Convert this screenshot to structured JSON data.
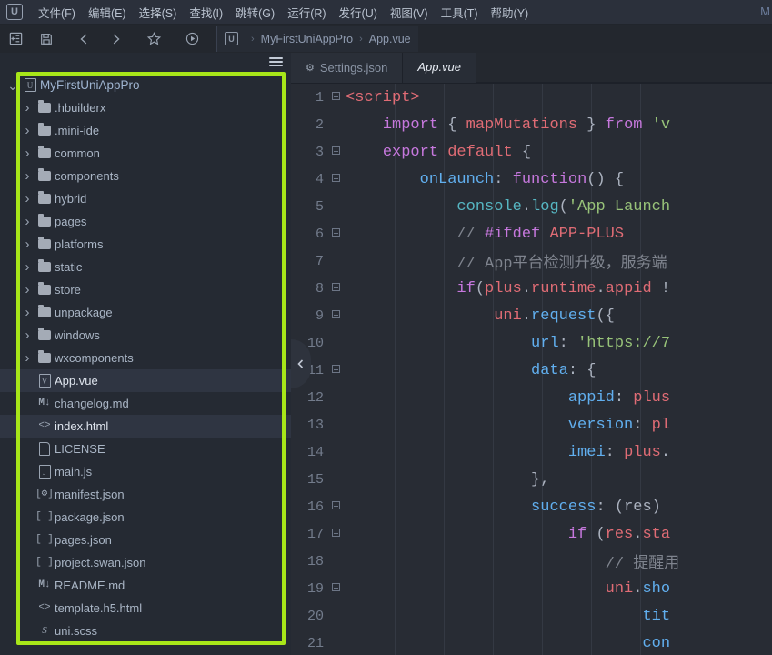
{
  "app": {
    "logo_letter": "U",
    "right_label": "M"
  },
  "menubar": {
    "items": [
      {
        "name": "file",
        "label": "文件(F)"
      },
      {
        "name": "edit",
        "label": "编辑(E)"
      },
      {
        "name": "select",
        "label": "选择(S)"
      },
      {
        "name": "find",
        "label": "查找(I)"
      },
      {
        "name": "goto",
        "label": "跳转(G)"
      },
      {
        "name": "run",
        "label": "运行(R)"
      },
      {
        "name": "publish",
        "label": "发行(U)"
      },
      {
        "name": "view",
        "label": "视图(V)"
      },
      {
        "name": "tools",
        "label": "工具(T)"
      },
      {
        "name": "help",
        "label": "帮助(Y)"
      }
    ]
  },
  "toolbar": {
    "buttons": [
      {
        "name": "new-file-button",
        "icon": "new-file-icon"
      },
      {
        "name": "save-button",
        "icon": "save-icon"
      },
      {
        "name": "back-button",
        "icon": "chevron-left-icon"
      },
      {
        "name": "forward-button",
        "icon": "chevron-right-icon"
      },
      {
        "name": "favorite-button",
        "icon": "star-icon"
      },
      {
        "name": "run-button",
        "icon": "play-circle-icon"
      }
    ],
    "breadcrumb": {
      "logo_letter": "U",
      "separator": "›",
      "items": [
        "MyFirstUniAppPro",
        "App.vue"
      ]
    }
  },
  "sidebar": {
    "menu_icon": "hamburger-icon",
    "tree": [
      {
        "label": "MyFirstUniAppPro",
        "type": "root",
        "icon": "project-icon",
        "expanded": true,
        "indent": 0,
        "selected": false
      },
      {
        "label": ".hbuilderx",
        "type": "folder",
        "icon": "folder-icon",
        "expanded": false,
        "indent": 1,
        "selected": false
      },
      {
        "label": ".mini-ide",
        "type": "folder",
        "icon": "folder-icon",
        "expanded": false,
        "indent": 1,
        "selected": false
      },
      {
        "label": "common",
        "type": "folder",
        "icon": "folder-icon",
        "expanded": false,
        "indent": 1,
        "selected": false
      },
      {
        "label": "components",
        "type": "folder",
        "icon": "folder-icon",
        "expanded": false,
        "indent": 1,
        "selected": false
      },
      {
        "label": "hybrid",
        "type": "folder",
        "icon": "folder-icon",
        "expanded": false,
        "indent": 1,
        "selected": false
      },
      {
        "label": "pages",
        "type": "folder",
        "icon": "folder-icon",
        "expanded": false,
        "indent": 1,
        "selected": false
      },
      {
        "label": "platforms",
        "type": "folder",
        "icon": "folder-icon",
        "expanded": false,
        "indent": 1,
        "selected": false
      },
      {
        "label": "static",
        "type": "folder",
        "icon": "folder-icon",
        "expanded": false,
        "indent": 1,
        "selected": false
      },
      {
        "label": "store",
        "type": "folder",
        "icon": "folder-icon",
        "expanded": false,
        "indent": 1,
        "selected": false
      },
      {
        "label": "unpackage",
        "type": "folder",
        "icon": "folder-icon",
        "expanded": false,
        "indent": 1,
        "selected": false
      },
      {
        "label": "windows",
        "type": "folder",
        "icon": "folder-icon",
        "expanded": false,
        "indent": 1,
        "selected": false
      },
      {
        "label": "wxcomponents",
        "type": "folder",
        "icon": "folder-icon",
        "expanded": false,
        "indent": 1,
        "selected": false
      },
      {
        "label": "App.vue",
        "type": "file",
        "icon": "vue-file-icon",
        "indent": 1,
        "selected": true
      },
      {
        "label": "changelog.md",
        "type": "file",
        "icon": "markdown-file-icon",
        "indent": 1,
        "selected": false
      },
      {
        "label": "index.html",
        "type": "file",
        "icon": "html-file-icon",
        "indent": 1,
        "selected": true
      },
      {
        "label": "LICENSE",
        "type": "file",
        "icon": "plain-file-icon",
        "indent": 1,
        "selected": false
      },
      {
        "label": "main.js",
        "type": "file",
        "icon": "js-file-icon",
        "indent": 1,
        "selected": false
      },
      {
        "label": "manifest.json",
        "type": "file",
        "icon": "manifest-file-icon",
        "indent": 1,
        "selected": false
      },
      {
        "label": "package.json",
        "type": "file",
        "icon": "json-file-icon",
        "indent": 1,
        "selected": false
      },
      {
        "label": "pages.json",
        "type": "file",
        "icon": "json-file-icon",
        "indent": 1,
        "selected": false
      },
      {
        "label": "project.swan.json",
        "type": "file",
        "icon": "json-file-icon",
        "indent": 1,
        "selected": false
      },
      {
        "label": "README.md",
        "type": "file",
        "icon": "markdown-file-icon",
        "indent": 1,
        "selected": false
      },
      {
        "label": "template.h5.html",
        "type": "file",
        "icon": "html-file-icon",
        "indent": 1,
        "selected": false
      },
      {
        "label": "uni.scss",
        "type": "file",
        "icon": "scss-file-icon",
        "indent": 1,
        "selected": false
      }
    ],
    "highlight_color": "#a8e619"
  },
  "editor": {
    "tabs": [
      {
        "label": "Settings.json",
        "icon": "gear-icon",
        "active": false
      },
      {
        "label": "App.vue",
        "icon": "",
        "active": true
      }
    ],
    "collapse_handle_icon": "chevron-left-icon",
    "code": {
      "language": "vue",
      "lines": [
        {
          "no": "1",
          "fold": "box",
          "indent": 0,
          "tokens": [
            {
              "t": "tag",
              "v": "<script>"
            }
          ]
        },
        {
          "no": "2",
          "fold": "bar",
          "indent": 1,
          "tokens": [
            {
              "t": "plain",
              "v": "    "
            },
            {
              "t": "kw",
              "v": "import"
            },
            {
              "t": "plain",
              "v": " "
            },
            {
              "t": "punc",
              "v": "{"
            },
            {
              "t": "plain",
              "v": " "
            },
            {
              "t": "var",
              "v": "mapMutations"
            },
            {
              "t": "plain",
              "v": " "
            },
            {
              "t": "punc",
              "v": "}"
            },
            {
              "t": "plain",
              "v": " "
            },
            {
              "t": "kw",
              "v": "from"
            },
            {
              "t": "plain",
              "v": " "
            },
            {
              "t": "str",
              "v": "'v"
            }
          ]
        },
        {
          "no": "3",
          "fold": "box",
          "indent": 1,
          "tokens": [
            {
              "t": "plain",
              "v": "    "
            },
            {
              "t": "kw",
              "v": "export"
            },
            {
              "t": "plain",
              "v": " "
            },
            {
              "t": "var",
              "v": "default"
            },
            {
              "t": "plain",
              "v": " "
            },
            {
              "t": "punc",
              "v": "{"
            }
          ]
        },
        {
          "no": "4",
          "fold": "box",
          "indent": 2,
          "tokens": [
            {
              "t": "plain",
              "v": "        "
            },
            {
              "t": "key",
              "v": "onLaunch"
            },
            {
              "t": "punc",
              "v": ":"
            },
            {
              "t": "plain",
              "v": " "
            },
            {
              "t": "kw",
              "v": "function"
            },
            {
              "t": "punc",
              "v": "()"
            },
            {
              "t": "plain",
              "v": " "
            },
            {
              "t": "punc",
              "v": "{"
            }
          ]
        },
        {
          "no": "5",
          "fold": "bar",
          "indent": 3,
          "tokens": [
            {
              "t": "plain",
              "v": "            "
            },
            {
              "t": "cyan",
              "v": "console"
            },
            {
              "t": "punc",
              "v": "."
            },
            {
              "t": "cyan",
              "v": "log"
            },
            {
              "t": "punc",
              "v": "("
            },
            {
              "t": "str",
              "v": "'App Launch"
            }
          ]
        },
        {
          "no": "6",
          "fold": "box",
          "indent": 3,
          "tokens": [
            {
              "t": "plain",
              "v": "            "
            },
            {
              "t": "cmt",
              "v": "// "
            },
            {
              "t": "kw",
              "v": "#ifdef"
            },
            {
              "t": "plain",
              "v": " "
            },
            {
              "t": "var",
              "v": "APP-PLUS"
            }
          ]
        },
        {
          "no": "7",
          "fold": "bar",
          "indent": 3,
          "tokens": [
            {
              "t": "plain",
              "v": "            "
            },
            {
              "t": "cmt",
              "v": "// App平台检测升级，服务端"
            }
          ]
        },
        {
          "no": "8",
          "fold": "box",
          "indent": 3,
          "tokens": [
            {
              "t": "plain",
              "v": "            "
            },
            {
              "t": "kw",
              "v": "if"
            },
            {
              "t": "punc",
              "v": "("
            },
            {
              "t": "var",
              "v": "plus"
            },
            {
              "t": "punc",
              "v": "."
            },
            {
              "t": "var",
              "v": "runtime"
            },
            {
              "t": "punc",
              "v": "."
            },
            {
              "t": "var",
              "v": "appid"
            },
            {
              "t": "plain",
              "v": " "
            },
            {
              "t": "punc",
              "v": "!"
            }
          ]
        },
        {
          "no": "9",
          "fold": "box",
          "indent": 4,
          "tokens": [
            {
              "t": "plain",
              "v": "                "
            },
            {
              "t": "var",
              "v": "uni"
            },
            {
              "t": "punc",
              "v": "."
            },
            {
              "t": "fn",
              "v": "request"
            },
            {
              "t": "punc",
              "v": "({"
            }
          ]
        },
        {
          "no": "10",
          "fold": "bar",
          "indent": 5,
          "tokens": [
            {
              "t": "plain",
              "v": "                    "
            },
            {
              "t": "key",
              "v": "url"
            },
            {
              "t": "punc",
              "v": ":"
            },
            {
              "t": "plain",
              "v": " "
            },
            {
              "t": "str",
              "v": "'https://7"
            }
          ]
        },
        {
          "no": "11",
          "fold": "box",
          "indent": 5,
          "tokens": [
            {
              "t": "plain",
              "v": "                    "
            },
            {
              "t": "key",
              "v": "data"
            },
            {
              "t": "punc",
              "v": ":"
            },
            {
              "t": "plain",
              "v": " "
            },
            {
              "t": "punc",
              "v": "{"
            }
          ]
        },
        {
          "no": "12",
          "fold": "bar",
          "indent": 6,
          "tokens": [
            {
              "t": "plain",
              "v": "                        "
            },
            {
              "t": "key",
              "v": "appid"
            },
            {
              "t": "punc",
              "v": ":"
            },
            {
              "t": "plain",
              "v": " "
            },
            {
              "t": "var",
              "v": "plus"
            }
          ]
        },
        {
          "no": "13",
          "fold": "bar",
          "indent": 6,
          "tokens": [
            {
              "t": "plain",
              "v": "                        "
            },
            {
              "t": "key",
              "v": "version"
            },
            {
              "t": "punc",
              "v": ":"
            },
            {
              "t": "plain",
              "v": " "
            },
            {
              "t": "var",
              "v": "pl"
            }
          ]
        },
        {
          "no": "14",
          "fold": "bar",
          "indent": 6,
          "tokens": [
            {
              "t": "plain",
              "v": "                        "
            },
            {
              "t": "key",
              "v": "imei"
            },
            {
              "t": "punc",
              "v": ":"
            },
            {
              "t": "plain",
              "v": " "
            },
            {
              "t": "var",
              "v": "plus"
            },
            {
              "t": "punc",
              "v": "."
            }
          ]
        },
        {
          "no": "15",
          "fold": "bar",
          "indent": 5,
          "tokens": [
            {
              "t": "plain",
              "v": "                    "
            },
            {
              "t": "punc",
              "v": "},"
            }
          ]
        },
        {
          "no": "16",
          "fold": "box",
          "indent": 5,
          "tokens": [
            {
              "t": "plain",
              "v": "                    "
            },
            {
              "t": "key",
              "v": "success"
            },
            {
              "t": "punc",
              "v": ":"
            },
            {
              "t": "plain",
              "v": " "
            },
            {
              "t": "punc",
              "v": "(res)"
            }
          ]
        },
        {
          "no": "17",
          "fold": "box",
          "indent": 6,
          "tokens": [
            {
              "t": "plain",
              "v": "                        "
            },
            {
              "t": "kw",
              "v": "if"
            },
            {
              "t": "plain",
              "v": " "
            },
            {
              "t": "punc",
              "v": "("
            },
            {
              "t": "var",
              "v": "res"
            },
            {
              "t": "punc",
              "v": "."
            },
            {
              "t": "var",
              "v": "sta"
            }
          ]
        },
        {
          "no": "18",
          "fold": "bar",
          "indent": 7,
          "tokens": [
            {
              "t": "plain",
              "v": "                            "
            },
            {
              "t": "cmt",
              "v": "// 提醒用"
            }
          ]
        },
        {
          "no": "19",
          "fold": "box",
          "indent": 7,
          "tokens": [
            {
              "t": "plain",
              "v": "                            "
            },
            {
              "t": "var",
              "v": "uni"
            },
            {
              "t": "punc",
              "v": "."
            },
            {
              "t": "fn",
              "v": "sho"
            }
          ]
        },
        {
          "no": "20",
          "fold": "bar",
          "indent": 8,
          "tokens": [
            {
              "t": "plain",
              "v": "                                "
            },
            {
              "t": "key",
              "v": "tit"
            }
          ]
        },
        {
          "no": "21",
          "fold": "bar",
          "indent": 8,
          "tokens": [
            {
              "t": "plain",
              "v": "                                "
            },
            {
              "t": "key",
              "v": "con"
            }
          ]
        }
      ]
    }
  }
}
